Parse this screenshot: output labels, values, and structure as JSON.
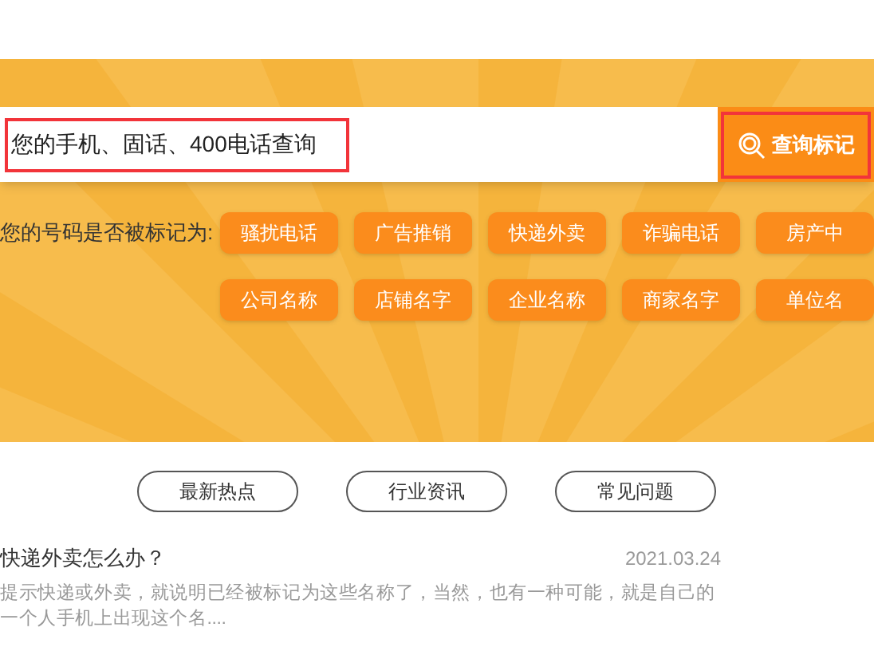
{
  "search": {
    "value": "您的手机、固话、400电话查询",
    "button": "查询标记"
  },
  "mark_label": "您的号码是否被标记为:",
  "tag_rows": [
    [
      "骚扰电话",
      "广告推销",
      "快递外卖",
      "诈骗电话",
      "房产中"
    ],
    [
      "公司名称",
      "店铺名字",
      "企业名称",
      "商家名字",
      "单位名"
    ]
  ],
  "tabs": [
    "最新热点",
    "行业资讯",
    "常见问题"
  ],
  "article": {
    "title": "快递外卖怎么办？",
    "date": "2021.03.24",
    "summary": "提示快递或外卖，就说明已经被标记为这些名称了，当然，也有一种可能，就是自己的一个人手机上出现这个名...."
  }
}
